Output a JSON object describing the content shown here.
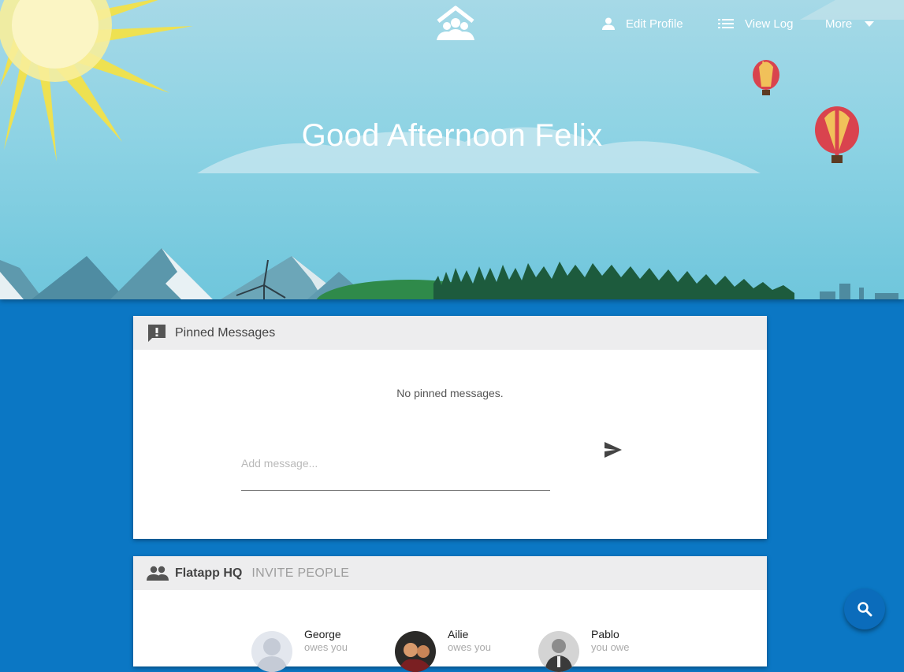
{
  "nav": {
    "edit_profile": "Edit Profile",
    "view_log": "View Log",
    "more": "More"
  },
  "hero": {
    "greeting": "Good Afternoon Felix"
  },
  "pinned": {
    "title": "Pinned Messages",
    "empty_text": "No pinned messages.",
    "input_placeholder": "Add message..."
  },
  "group": {
    "name": "Flatapp HQ",
    "invite_label": "INVITE PEOPLE",
    "members": [
      {
        "name": "George",
        "debt_label": "owes you"
      },
      {
        "name": "Ailie",
        "debt_label": "owes you"
      },
      {
        "name": "Pablo",
        "debt_label": "you owe"
      }
    ]
  },
  "icons": {
    "logo": "house-people-icon",
    "profile": "person-icon",
    "log": "list-icon",
    "more": "caret-down-icon",
    "pinned": "message-alert-icon",
    "group": "people-icon",
    "send": "send-icon",
    "fab": "search-icon"
  },
  "colors": {
    "page_background": "#0b77c4",
    "fab": "#0b6cbb",
    "card_header": "#ededee"
  }
}
